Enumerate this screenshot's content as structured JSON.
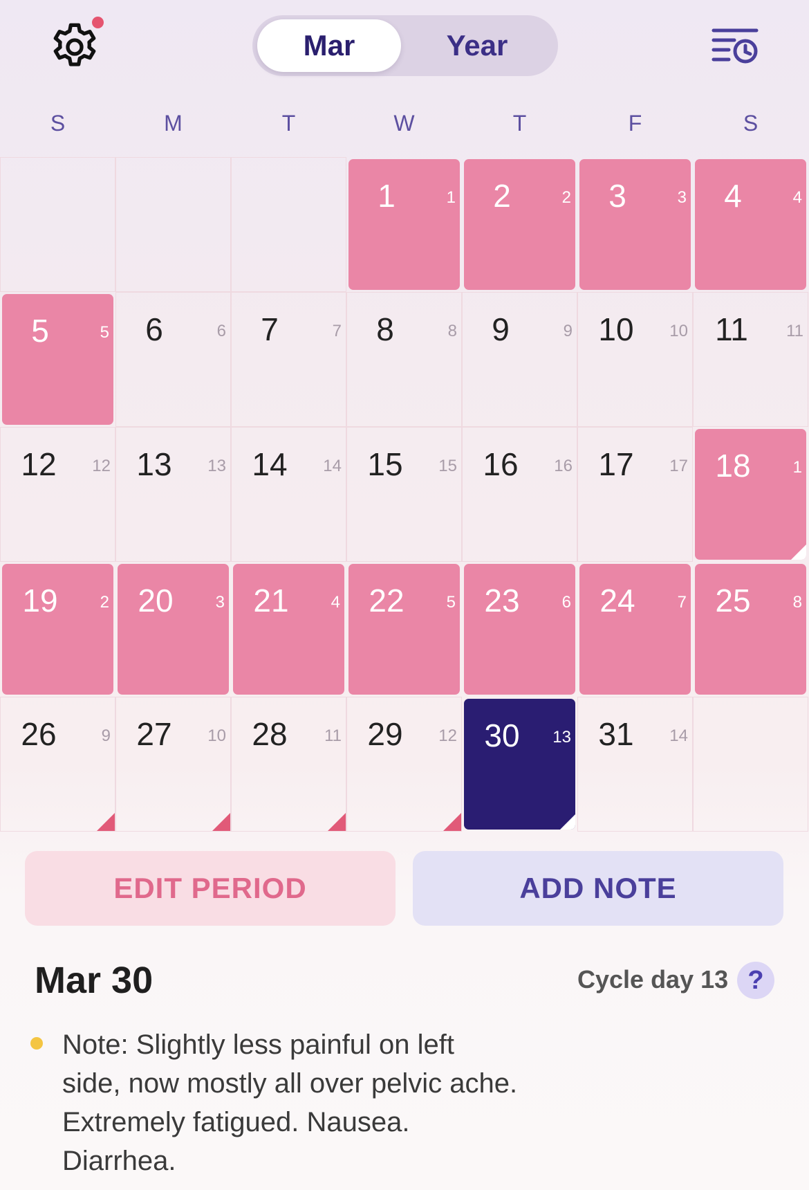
{
  "header": {
    "settings_icon": "gear-icon",
    "segments": {
      "month": "Mar",
      "year": "Year"
    },
    "active_segment": "month",
    "history_icon": "history-list-icon"
  },
  "weekdays": [
    "S",
    "M",
    "T",
    "W",
    "T",
    "F",
    "S"
  ],
  "calendar": {
    "month_label": "Mar",
    "days": [
      {
        "day": "1",
        "cycle": "1",
        "state": "period"
      },
      {
        "day": "2",
        "cycle": "2",
        "state": "period"
      },
      {
        "day": "3",
        "cycle": "3",
        "state": "period"
      },
      {
        "day": "4",
        "cycle": "4",
        "state": "period"
      },
      {
        "day": "5",
        "cycle": "5",
        "state": "period"
      },
      {
        "day": "6",
        "cycle": "6",
        "state": "normal"
      },
      {
        "day": "7",
        "cycle": "7",
        "state": "normal"
      },
      {
        "day": "8",
        "cycle": "8",
        "state": "normal"
      },
      {
        "day": "9",
        "cycle": "9",
        "state": "normal"
      },
      {
        "day": "10",
        "cycle": "10",
        "state": "normal"
      },
      {
        "day": "11",
        "cycle": "11",
        "state": "normal"
      },
      {
        "day": "12",
        "cycle": "12",
        "state": "normal"
      },
      {
        "day": "13",
        "cycle": "13",
        "state": "normal"
      },
      {
        "day": "14",
        "cycle": "14",
        "state": "normal"
      },
      {
        "day": "15",
        "cycle": "15",
        "state": "normal"
      },
      {
        "day": "16",
        "cycle": "16",
        "state": "normal"
      },
      {
        "day": "17",
        "cycle": "17",
        "state": "normal"
      },
      {
        "day": "18",
        "cycle": "1",
        "state": "period",
        "note": true
      },
      {
        "day": "19",
        "cycle": "2",
        "state": "period"
      },
      {
        "day": "20",
        "cycle": "3",
        "state": "period"
      },
      {
        "day": "21",
        "cycle": "4",
        "state": "period"
      },
      {
        "day": "22",
        "cycle": "5",
        "state": "period"
      },
      {
        "day": "23",
        "cycle": "6",
        "state": "period"
      },
      {
        "day": "24",
        "cycle": "7",
        "state": "period"
      },
      {
        "day": "25",
        "cycle": "8",
        "state": "period"
      },
      {
        "day": "26",
        "cycle": "9",
        "state": "normal",
        "note": true
      },
      {
        "day": "27",
        "cycle": "10",
        "state": "normal",
        "note": true
      },
      {
        "day": "28",
        "cycle": "11",
        "state": "normal",
        "note": true
      },
      {
        "day": "29",
        "cycle": "12",
        "state": "normal",
        "note": true
      },
      {
        "day": "30",
        "cycle": "13",
        "state": "selected",
        "note": true
      },
      {
        "day": "31",
        "cycle": "14",
        "state": "normal"
      }
    ]
  },
  "actions": {
    "edit_period": "EDIT PERIOD",
    "add_note": "ADD NOTE"
  },
  "detail": {
    "date": "Mar 30",
    "cycle_day": "Cycle day 13",
    "help": "?",
    "note": "Note: Slightly less painful on left side, now mostly all over pelvic ache. Extremely fatigued. Nausea. Diarrhea."
  },
  "colors": {
    "period": "#ea86a6",
    "selected": "#2a1d72",
    "note_corner": "#e15a78",
    "note_bullet": "#f4c542",
    "accent_text": "#2a1f6e"
  }
}
